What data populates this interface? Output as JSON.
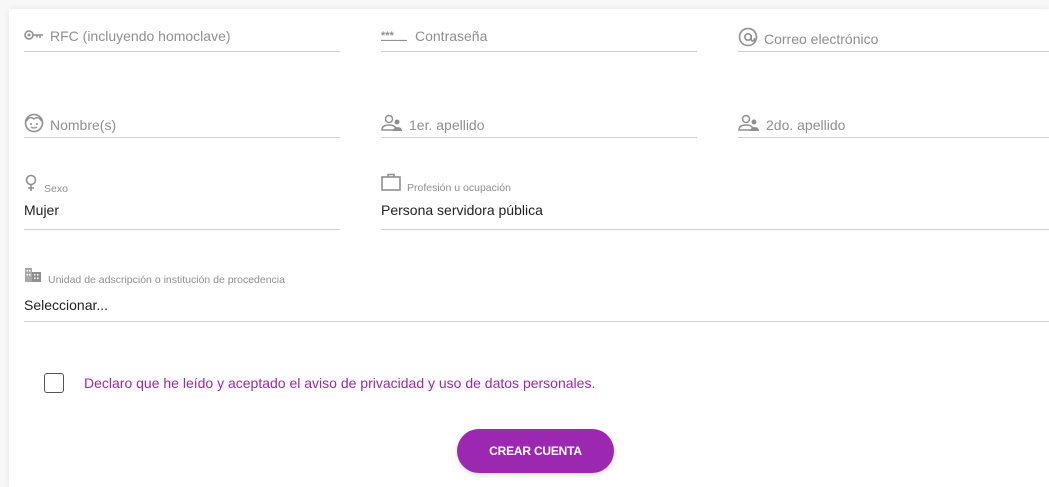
{
  "form": {
    "rfc": {
      "placeholder": "RFC (incluyendo homoclave)",
      "icon": "key-icon"
    },
    "password": {
      "placeholder": "Contraseña",
      "icon": "password-dots-icon"
    },
    "email": {
      "placeholder": "Correo electrónico",
      "icon": "at-icon"
    },
    "first_name": {
      "placeholder": "Nombre(s)",
      "icon": "face-icon"
    },
    "last_name_1": {
      "placeholder": "1er. apellido",
      "icon": "people-icon"
    },
    "last_name_2": {
      "placeholder": "2do. apellido",
      "icon": "people-icon"
    },
    "sex": {
      "label": "Sexo",
      "value": "Mujer",
      "icon": "female-icon"
    },
    "profession": {
      "label": "Profesión u ocupación",
      "value": "Persona servidora pública",
      "icon": "briefcase-icon"
    },
    "institution": {
      "label": "Unidad de adscripción o institución de procedencia",
      "value": "Seleccionar...",
      "icon": "buildings-icon"
    }
  },
  "consent": {
    "text": "Declaro que he leído y aceptado el aviso de privacidad y uso de datos personales.",
    "checked": false
  },
  "submit": {
    "label": "CREAR CUENTA"
  },
  "colors": {
    "accent": "#9c27b0",
    "line": "#cfcfcf",
    "placeholder": "#8f8f8f"
  }
}
